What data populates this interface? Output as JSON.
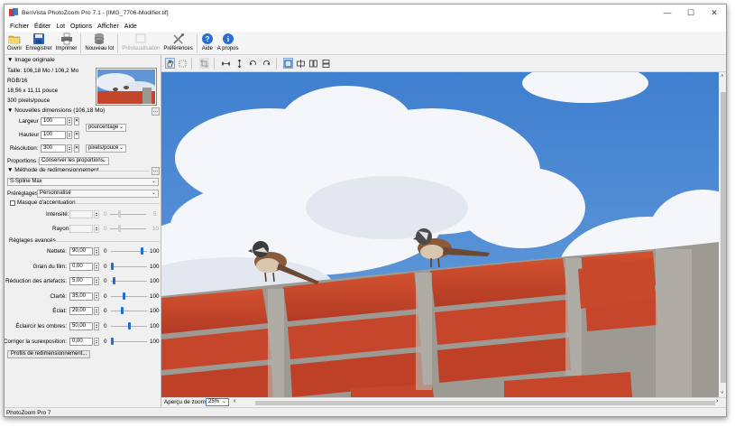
{
  "window": {
    "title": "BenVista PhotoZoom Pro 7.1 - [IMG_7706-Modifier.tif]",
    "controls": {
      "minimize": "—",
      "maximize": "☐",
      "close": "✕"
    }
  },
  "menu": [
    "Fichier",
    "Éditer",
    "Lot",
    "Options",
    "Afficher",
    "Aide"
  ],
  "toolbar": {
    "buttons": [
      {
        "label": "Ouvrir",
        "icon": "folder-icon"
      },
      {
        "label": "Enregistrer",
        "icon": "save-icon"
      },
      {
        "label": "Imprimer",
        "icon": "printer-icon"
      },
      {
        "label": "Nouveau lot",
        "icon": "database-icon"
      },
      {
        "label": "Prévisualisation",
        "icon": "preview-icon",
        "disabled": true
      },
      {
        "label": "Préférences",
        "icon": "tools-icon"
      },
      {
        "label": "Aide",
        "icon": "help-icon"
      },
      {
        "label": "A propos",
        "icon": "info-icon"
      }
    ]
  },
  "original": {
    "header": "Image originale",
    "size": "Taille: 106,18 Mo / 106,2 Mo",
    "mode": "RGB/16",
    "dimensions": "18,56 x 11,11 pouce",
    "resolution": "300 pixels/pouce"
  },
  "new_dims": {
    "header": "Nouvelles dimensions (106,18 Mo)",
    "width_label": "Largeur",
    "width_value": "100",
    "height_label": "Hauteur",
    "height_value": "100",
    "unit": "pourcentage",
    "res_label": "Résolution:",
    "res_value": "300",
    "res_unit": "pixels/pouce",
    "prop_label": "Proportions :",
    "prop_value": "Conserver les proportions"
  },
  "method": {
    "header": "Méthode de redimensionnement",
    "algorithm": "S-Spline Max",
    "preset_label": "Préréglages:",
    "preset_value": "Personnalisé"
  },
  "unsharp": {
    "checkbox_label": "Masque d'accentuation",
    "intensity_label": "Intensité:",
    "intensity_min": "0",
    "intensity_max": "5",
    "radius_label": "Rayon:",
    "radius_min": "0",
    "radius_max": "10"
  },
  "advanced": {
    "header": "Réglages avancés",
    "rows": [
      {
        "label": "Netteté:",
        "value": "90,00",
        "min": "0",
        "max": "100",
        "level": 0.9
      },
      {
        "label": "Grain du film:",
        "value": "0,00",
        "min": "0",
        "max": "100",
        "level": 0.0
      },
      {
        "label": "Réduction des artefacts:",
        "value": "5,00",
        "min": "0",
        "max": "100",
        "level": 0.05
      },
      {
        "label": "Clarté:",
        "value": "35,00",
        "min": "0",
        "max": "100",
        "level": 0.35
      },
      {
        "label": "Éclat:",
        "value": "29,00",
        "min": "0",
        "max": "100",
        "level": 0.29
      },
      {
        "label": "Éclaircir les ombres:",
        "value": "50,00",
        "min": "0",
        "max": "100",
        "level": 0.5
      },
      {
        "label": "Corriger la surexposition:",
        "value": "0,00",
        "min": "0",
        "max": "100",
        "level": 0.0
      }
    ],
    "profiles_button": "Profils de redimensionnement..."
  },
  "zoom": {
    "label": "Aperçu de zoom :",
    "value": "25%"
  },
  "status": "PhotoZoom Pro 7",
  "colors": {
    "sky": "#4e8fd6",
    "brick": "#c3452b",
    "mortar": "#9b9892",
    "slider": "#1e6ed6"
  }
}
